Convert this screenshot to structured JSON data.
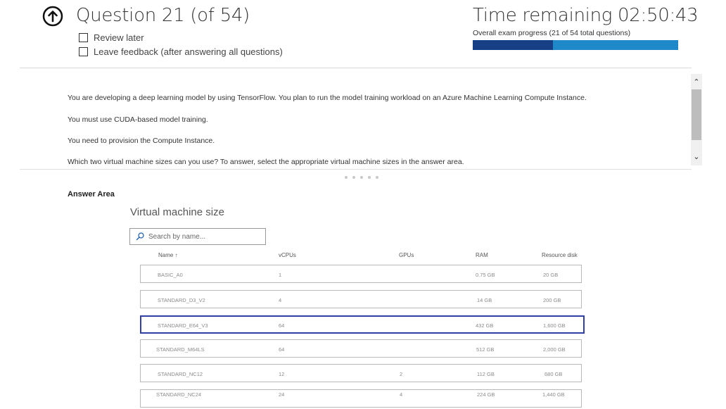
{
  "header": {
    "question_label": "Question 21 (of 54)",
    "review_later": "Review later",
    "leave_feedback": "Leave feedback (after answering all questions)",
    "time_remaining": "Time remaining 02:50:43",
    "progress_label": "Overall exam progress (21 of 54 total questions)",
    "progress_fraction": 0.39
  },
  "question": {
    "lines": [
      "You are developing a deep learning model by using TensorFlow. You plan to run the model training workload on an Azure Machine Learning Compute Instance.",
      "You must use CUDA-based model training.",
      "You need to provision the Compute Instance.",
      "Which two virtual machine sizes can you use? To answer, select the appropriate virtual machine sizes in the answer area."
    ]
  },
  "answer_area": {
    "label": "Answer Area",
    "title": "Virtual machine size",
    "search_placeholder": "Search by name...",
    "columns": {
      "name": "Name ↑",
      "vcpus": "vCPUs",
      "gpus": "GPUs",
      "ram": "RAM",
      "disk": "Resource disk"
    },
    "rows": [
      {
        "name": "BASIC_A0",
        "vcpus": "1",
        "gpus": "",
        "ram": "0.75 GB",
        "disk": "20 GB",
        "selected": false
      },
      {
        "name": "STANDARD_D3_V2",
        "vcpus": "4",
        "gpus": "",
        "ram": "14 GB",
        "disk": "200 GB",
        "selected": false
      },
      {
        "name": "STANDARD_E64_V3",
        "vcpus": "64",
        "gpus": "",
        "ram": "432 GB",
        "disk": "1,600 GB",
        "selected": true
      },
      {
        "name": "STANDARD_M64LS",
        "vcpus": "64",
        "gpus": "",
        "ram": "512 GB",
        "disk": "2,000 GB",
        "selected": false
      },
      {
        "name": "STANDARD_NC12",
        "vcpus": "12",
        "gpus": "2",
        "ram": "112 GB",
        "disk": "680 GB",
        "selected": false
      },
      {
        "name": "STANDARD_NC24",
        "vcpus": "24",
        "gpus": "4",
        "ram": "224 GB",
        "disk": "1,440 GB",
        "selected": false
      }
    ]
  },
  "colors": {
    "progress_done": "#173f85",
    "progress_remaining": "#1e88c8",
    "selected_border": "#2f3fa3"
  }
}
